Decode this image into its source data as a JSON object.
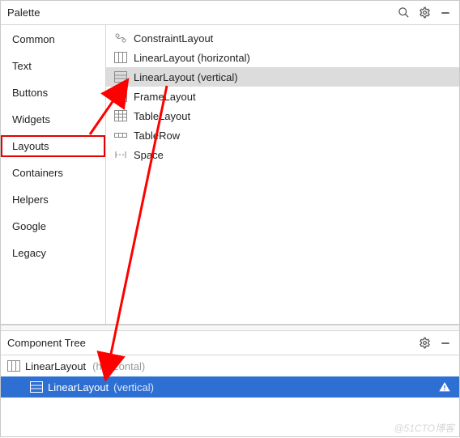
{
  "palette": {
    "title": "Palette",
    "categories": [
      "Common",
      "Text",
      "Buttons",
      "Widgets",
      "Layouts",
      "Containers",
      "Helpers",
      "Google",
      "Legacy"
    ],
    "selected_category": "Layouts",
    "items": [
      {
        "icon": "constraint",
        "label": "ConstraintLayout"
      },
      {
        "icon": "hstack",
        "label": "LinearLayout (horizontal)"
      },
      {
        "icon": "vstack",
        "label": "LinearLayout (vertical)"
      },
      {
        "icon": "frame",
        "label": "FrameLayout"
      },
      {
        "icon": "table",
        "label": "TableLayout"
      },
      {
        "icon": "row",
        "label": "TableRow"
      },
      {
        "icon": "space",
        "label": "Space"
      }
    ],
    "selected_item": "LinearLayout (vertical)"
  },
  "component_tree": {
    "title": "Component Tree",
    "root": {
      "icon": "hstack",
      "label": "LinearLayout",
      "suffix": "(horizontal)"
    },
    "child": {
      "icon": "vstack",
      "label": "LinearLayout",
      "suffix": "(vertical)",
      "warning": true
    }
  },
  "watermark": "@51CTO博客"
}
